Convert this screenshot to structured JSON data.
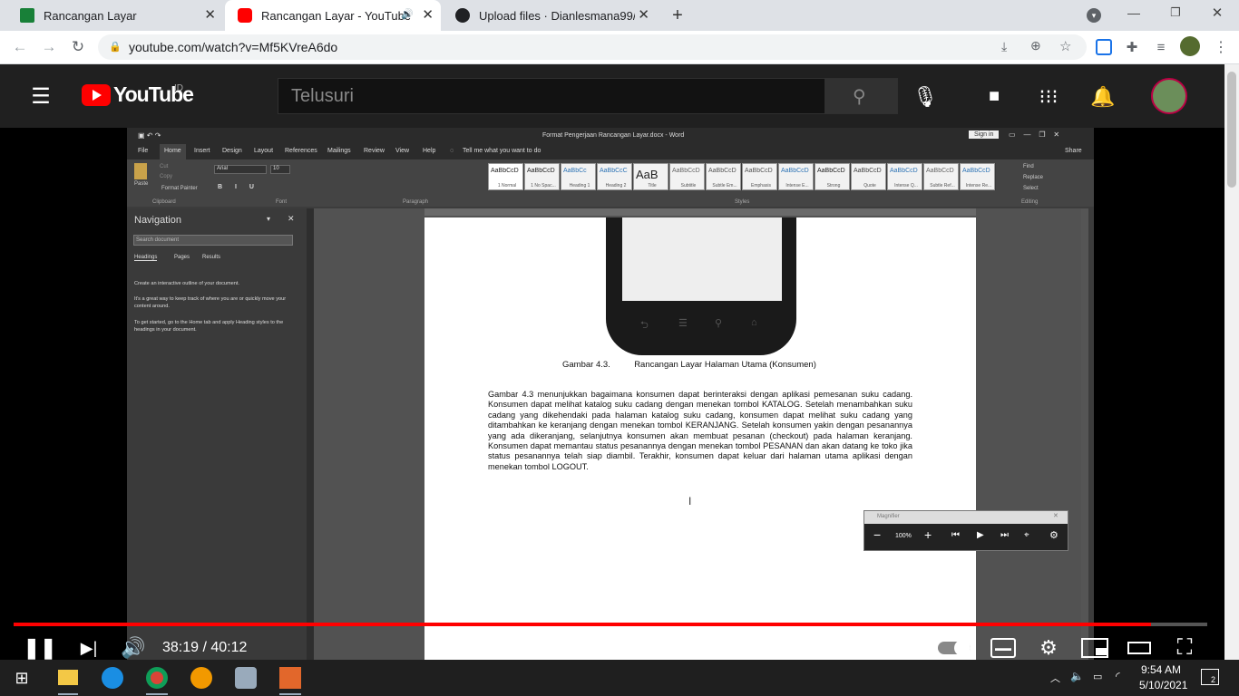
{
  "tabs": [
    {
      "title": "Rancangan Layar",
      "color": "#188038"
    },
    {
      "title": "Rancangan Layar - YouTube",
      "color": "#ff0000"
    },
    {
      "title": "Upload files · Dianlesmana99/sad",
      "color": "#202124"
    }
  ],
  "url": "youtube.com/watch?v=Mf5KVreA6do",
  "youtube": {
    "logo": "YouTube",
    "region": "ID",
    "search_placeholder": "Telusuri"
  },
  "word": {
    "doc_title": "Format Pengerjaan Rancangan Layar.docx  -  Word",
    "sign_in": "Sign in",
    "share": "Share",
    "tell_me": "Tell me what you want to do",
    "menu": [
      "File",
      "Home",
      "Insert",
      "Design",
      "Layout",
      "References",
      "Mailings",
      "Review",
      "View",
      "Help"
    ],
    "clipboard": {
      "paste": "Paste",
      "cut": "Cut",
      "copy": "Copy",
      "format_painter": "Format Painter",
      "group": "Clipboard"
    },
    "font": {
      "name": "Arial",
      "size": "10",
      "group": "Font"
    },
    "paragraph_group": "Paragraph",
    "styles_group": "Styles",
    "editing": {
      "find": "Find",
      "replace": "Replace",
      "select": "Select",
      "group": "Editing"
    },
    "styles": [
      {
        "sample": "AaBbCcD",
        "name": "1 Normal"
      },
      {
        "sample": "AaBbCcD",
        "name": "1 No Spac..."
      },
      {
        "sample": "AaBbCc",
        "name": "Heading 1"
      },
      {
        "sample": "AaBbCcC",
        "name": "Heading 2"
      },
      {
        "sample": "AaB",
        "name": "Title"
      },
      {
        "sample": "AaBbCcD",
        "name": "Subtitle"
      },
      {
        "sample": "AaBbCcD",
        "name": "Subtle Em..."
      },
      {
        "sample": "AaBbCcD",
        "name": "Emphasis"
      },
      {
        "sample": "AaBbCcD",
        "name": "Intense E..."
      },
      {
        "sample": "AaBbCcD",
        "name": "Strong"
      },
      {
        "sample": "AaBbCcD",
        "name": "Quote"
      },
      {
        "sample": "AaBbCcD",
        "name": "Intense Q..."
      },
      {
        "sample": "AaBbCcD",
        "name": "Subtle Ref..."
      },
      {
        "sample": "AaBbCcD",
        "name": "Intense Re..."
      }
    ],
    "navigation": {
      "title": "Navigation",
      "search_placeholder": "Search document",
      "tabs": [
        "Headings",
        "Pages",
        "Results"
      ],
      "text1": "Create an interactive outline of your document.",
      "text2": "It's a great way to keep track of where you are or quickly move your content around.",
      "text3": "To get started, go to the Home tab and apply Heading styles to the headings in your document."
    },
    "caption": "Gambar 4.3.          Rancangan Layar Halaman Utama (Konsumen)",
    "paragraph": "Gambar 4.3 menunjukkan bagaimana konsumen dapat berinteraksi dengan aplikasi pemesanan suku cadang. Konsumen dapat melihat katalog suku cadang dengan menekan tombol KATALOG. Setelah menambahkan suku cadang yang dikehendaki pada halaman katalog suku cadang, konsumen dapat melihat suku cadang yang ditambahkan ke keranjang dengan menekan tombol KERANJANG. Setelah konsumen yakin dengan pesanannya yang ada dikeranjang, selanjutnya konsumen akan membuat pesanan (checkout) pada halaman keranjang. Konsumen dapat memantau status pesanannya dengan menekan tombol PESANAN dan akan datang ke toko jika status pesanannya telah siap diambil. Terakhir, konsumen dapat keluar dari halaman utama aplikasi dengan menekan tombol LOGOUT.",
    "magnifier": {
      "title": "Magnifier",
      "zoom": "100%"
    }
  },
  "player": {
    "time": "38:19 / 40:12",
    "progress": 0.953
  },
  "taskbar": {
    "time": "9:54 AM",
    "date": "5/10/2021",
    "notifications": "2"
  }
}
